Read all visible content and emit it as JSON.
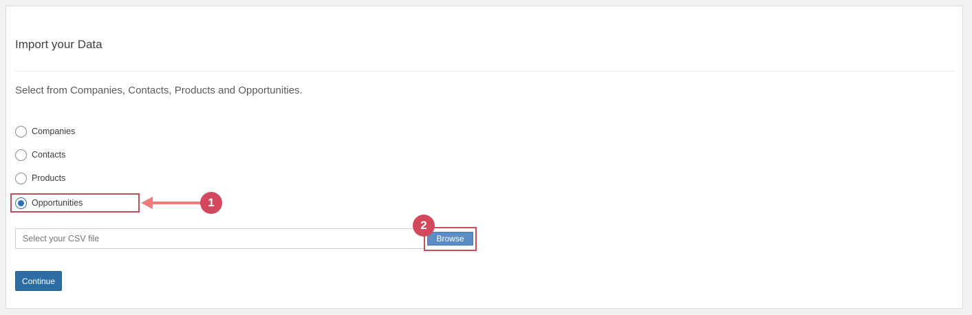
{
  "page": {
    "title": "Import your Data",
    "subtitle": "Select from Companies, Contacts, Products and Opportunities."
  },
  "options": [
    {
      "label": "Companies",
      "checked": false
    },
    {
      "label": "Contacts",
      "checked": false
    },
    {
      "label": "Products",
      "checked": false
    },
    {
      "label": "Opportunities",
      "checked": true
    }
  ],
  "file": {
    "placeholder": "Select your CSV file",
    "browse_label": "Browse"
  },
  "actions": {
    "continue_label": "Continue"
  },
  "annotations": {
    "marker_1": "1",
    "marker_2": "2",
    "accent_color": "#d2495d",
    "arrow_color": "#ec7d7a"
  }
}
